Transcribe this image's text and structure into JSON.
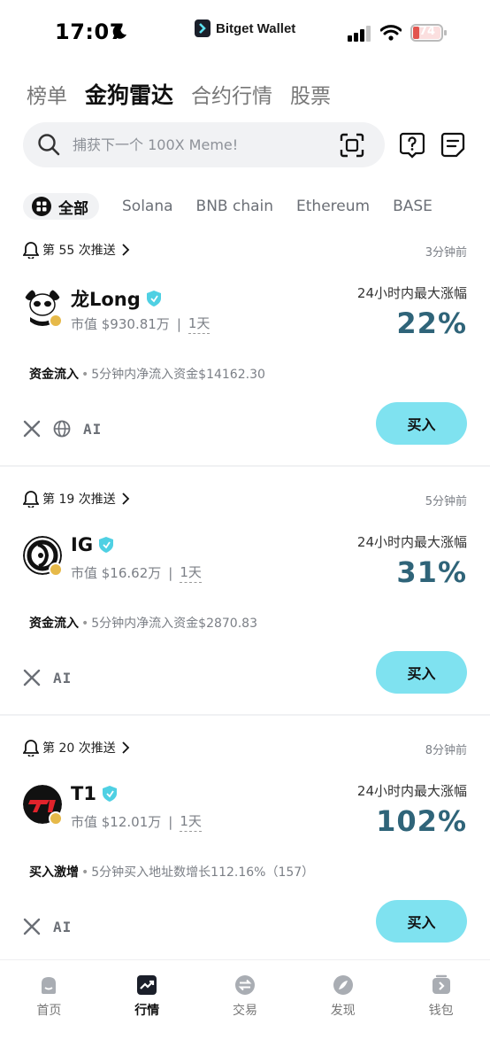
{
  "status_bar": {
    "time": "17:07",
    "brand": "Bitget Wallet",
    "battery": "74"
  },
  "top_tabs": [
    {
      "label": "榜单",
      "active": false
    },
    {
      "label": "金狗雷达",
      "active": true
    },
    {
      "label": "合约行情",
      "active": false
    },
    {
      "label": "股票",
      "active": false
    }
  ],
  "search": {
    "placeholder": "捕获下一个 100X Meme!"
  },
  "chains": {
    "all_label": "全部",
    "items": [
      "Solana",
      "BNB chain",
      "Ethereum",
      "BASE"
    ]
  },
  "cards": [
    {
      "push_label": "第 55 次推送",
      "time_ago": "3分钟前",
      "token_name": "龙Long",
      "mcap": "市值 $930.81万",
      "period": "1天",
      "gain_label": "24小时内最大涨幅",
      "gain_value": "22%",
      "signal_type": "资金流入",
      "signal_detail": "5分钟内净流入资金$14162.30",
      "links": [
        "x",
        "web",
        "ai"
      ],
      "buy_label": "买入"
    },
    {
      "push_label": "第 19 次推送",
      "time_ago": "5分钟前",
      "token_name": "IG",
      "mcap": "市值 $16.62万",
      "period": "1天",
      "gain_label": "24小时内最大涨幅",
      "gain_value": "31%",
      "signal_type": "资金流入",
      "signal_detail": "5分钟内净流入资金$2870.83",
      "links": [
        "x",
        "ai"
      ],
      "buy_label": "买入"
    },
    {
      "push_label": "第 20 次推送",
      "time_ago": "8分钟前",
      "token_name": "T1",
      "mcap": "市值 $12.01万",
      "period": "1天",
      "gain_label": "24小时内最大涨幅",
      "gain_value": "102%",
      "signal_type": "买入激增",
      "signal_detail": "5分钟买入地址数增长112.16%（157）",
      "links": [
        "x",
        "ai"
      ],
      "buy_label": "买入"
    }
  ],
  "ai_label": "AI",
  "bottom_nav": [
    {
      "label": "首页",
      "icon": "home-icon",
      "active": false
    },
    {
      "label": "行情",
      "icon": "market-chart-icon",
      "active": true
    },
    {
      "label": "交易",
      "icon": "swap-icon",
      "active": false
    },
    {
      "label": "发现",
      "icon": "compass-icon",
      "active": false
    },
    {
      "label": "钱包",
      "icon": "wallet-icon",
      "active": false
    }
  ],
  "colors": {
    "accent_buy": "#7fe2f0",
    "gain": "#2f6479",
    "verify": "#4fd0e3"
  }
}
